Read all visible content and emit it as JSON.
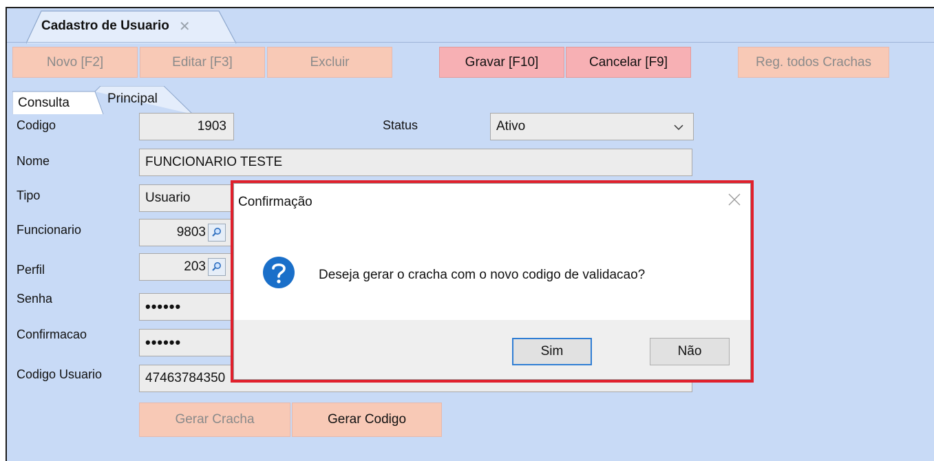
{
  "document_tab": {
    "title": "Cadastro de Usuario",
    "close_glyph": "✕"
  },
  "toolbar": {
    "novo": "Novo [F2]",
    "editar": "Editar [F3]",
    "excluir": "Excluir",
    "gravar": "Gravar [F10]",
    "cancelar": "Cancelar [F9]",
    "reg_crachas": "Reg. todos Crachas"
  },
  "tabs": {
    "consulta": "Consulta",
    "principal": "Principal"
  },
  "form": {
    "codigo_label": "Codigo",
    "codigo_value": "1903",
    "status_label": "Status",
    "status_value": "Ativo",
    "nome_label": "Nome",
    "nome_value": "FUNCIONARIO TESTE",
    "tipo_label": "Tipo",
    "tipo_value": "Usuario",
    "funcionario_label": "Funcionario",
    "funcionario_value": "9803",
    "perfil_label": "Perfil",
    "perfil_value": "203",
    "senha_label": "Senha",
    "senha_value": "••••••",
    "confirmacao_label": "Confirmacao",
    "confirmacao_value": "••••••",
    "codigo_usuario_label": "Codigo Usuario",
    "codigo_usuario_value": "47463784350"
  },
  "actions": {
    "gerar_cracha": "Gerar Cracha",
    "gerar_codigo": "Gerar Codigo"
  },
  "dialog": {
    "title": "Confirmação",
    "message": "Deseja gerar o cracha com o novo codigo de validacao?",
    "yes": "Sim",
    "no": "Não"
  },
  "colors": {
    "background": "#c8daf6",
    "disabled_button": "#f8c9b6",
    "active_button": "#f7b0b4",
    "highlight_border": "#e0202c",
    "question_icon": "#1a6fc9"
  },
  "icons": {
    "lookup": "magnifier-icon",
    "question": "question-icon",
    "dropdown": "chevron-down-icon"
  }
}
